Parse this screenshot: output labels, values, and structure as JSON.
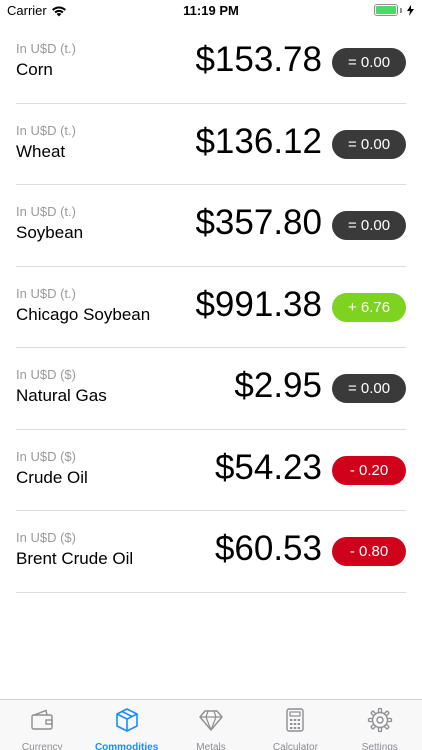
{
  "status_bar": {
    "carrier": "Carrier",
    "time": "11:19 PM"
  },
  "colors": {
    "neutral_badge": "#3a3a3a",
    "up_badge": "#7ed321",
    "down_badge": "#d0021b",
    "active_tab": "#1a8cff",
    "inactive_tab": "#8e8e93"
  },
  "commodities": [
    {
      "unit": "In U$D (t.)",
      "name": "Corn",
      "price": "$153.78",
      "change": "= 0.00",
      "trend": "neutral"
    },
    {
      "unit": "In U$D (t.)",
      "name": "Wheat",
      "price": "$136.12",
      "change": "= 0.00",
      "trend": "neutral"
    },
    {
      "unit": "In U$D (t.)",
      "name": "Soybean",
      "price": "$357.80",
      "change": "= 0.00",
      "trend": "neutral"
    },
    {
      "unit": "In U$D (t.)",
      "name": "Chicago Soybean",
      "price": "$991.38",
      "change": "+ 6.76",
      "trend": "up"
    },
    {
      "unit": "In U$D ($)",
      "name": "Natural Gas",
      "price": "$2.95",
      "change": "= 0.00",
      "trend": "neutral"
    },
    {
      "unit": "In U$D ($)",
      "name": "Crude Oil",
      "price": "$54.23",
      "change": "- 0.20",
      "trend": "down"
    },
    {
      "unit": "In U$D ($)",
      "name": "Brent Crude Oil",
      "price": "$60.53",
      "change": "- 0.80",
      "trend": "down"
    }
  ],
  "tab_bar": {
    "tabs": [
      {
        "label": "Currency",
        "icon": "wallet-icon",
        "active": false
      },
      {
        "label": "Commodities",
        "icon": "box-icon",
        "active": true
      },
      {
        "label": "Metals",
        "icon": "diamond-icon",
        "active": false
      },
      {
        "label": "Calculator",
        "icon": "calculator-icon",
        "active": false
      },
      {
        "label": "Settings",
        "icon": "gear-icon",
        "active": false
      }
    ]
  }
}
